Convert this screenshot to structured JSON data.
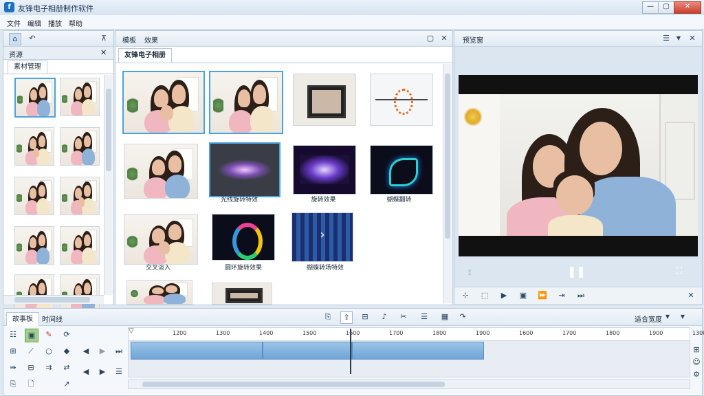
{
  "window": {
    "title": "友锋电子相册制作软件",
    "app_icon_glyph": "f",
    "controls": {
      "minimize": "—",
      "maximize": "▢",
      "close": "✕"
    }
  },
  "menu": [
    "文件",
    "编辑",
    "播放",
    "帮助"
  ],
  "left_panel": {
    "title": "资源",
    "tab": "素材管理",
    "close": "✕"
  },
  "center_panel": {
    "tabs": [
      "模板",
      "效果"
    ],
    "album_tab": "友锋电子相册",
    "captions": [
      "光线旋转特效",
      "旋转效果",
      "蝴蝶翻转",
      "交叉淡入",
      "圆环旋转效果",
      "蝴蝶转场特效"
    ]
  },
  "preview_panel": {
    "title": "预览窗",
    "pause_label": "❚❚"
  },
  "timeline": {
    "tabs": [
      "故事板",
      "时间线"
    ],
    "zoom_label": "适合宽度",
    "ruler": [
      "1200",
      "1300",
      "1400",
      "1500",
      "1600",
      "1700",
      "1800",
      "1900",
      "1600",
      "1700",
      "1800",
      "1900",
      "1300"
    ]
  },
  "icons": {
    "home": "home-icon",
    "back": "back-arrow-icon",
    "pin": "pin-icon",
    "close": "close-icon",
    "pause": "pause-icon",
    "play": "play-icon"
  },
  "colors": {
    "accent": "#4aa3e0",
    "clip": "#6ea5d6",
    "panel_border": "#b8c9da"
  }
}
